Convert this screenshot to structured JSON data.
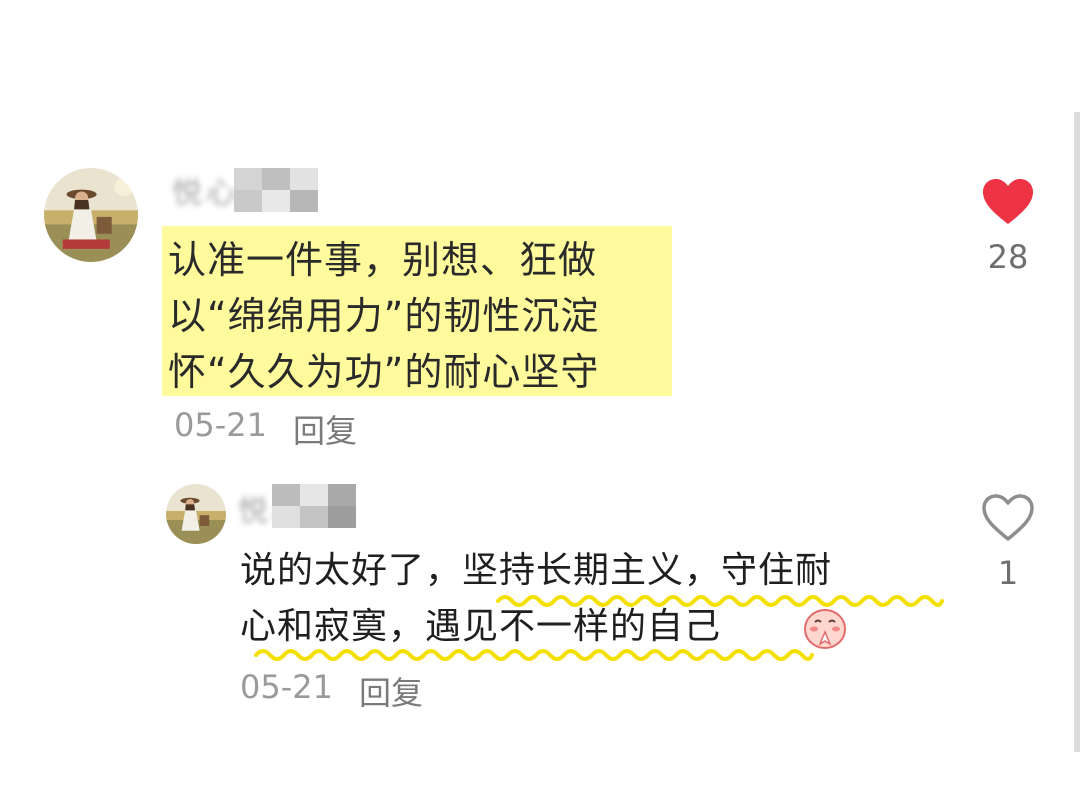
{
  "comment": {
    "username_text": "悦心成长",
    "lines": [
      "认准一件事，别想、狂做",
      "以“绵绵用力”的韧性沉淀",
      "怀“久久为功”的耐心坚守"
    ],
    "date": "05-21",
    "reply_label": "回复",
    "likes": "28",
    "highlight_color": "#fffb9c",
    "like_icon": "heart-filled-icon",
    "like_color": "#ee3344"
  },
  "reply": {
    "username_text": "悦心",
    "lines": [
      "说的太好了，坚持长期主义，守住耐",
      "心和寂寞，遇见不一样的自己"
    ],
    "emoji": "blushing-praying-face",
    "date": "05-21",
    "reply_label": "回复",
    "likes": "1",
    "like_icon": "heart-outline-icon",
    "underline_color": "#f3e000"
  }
}
